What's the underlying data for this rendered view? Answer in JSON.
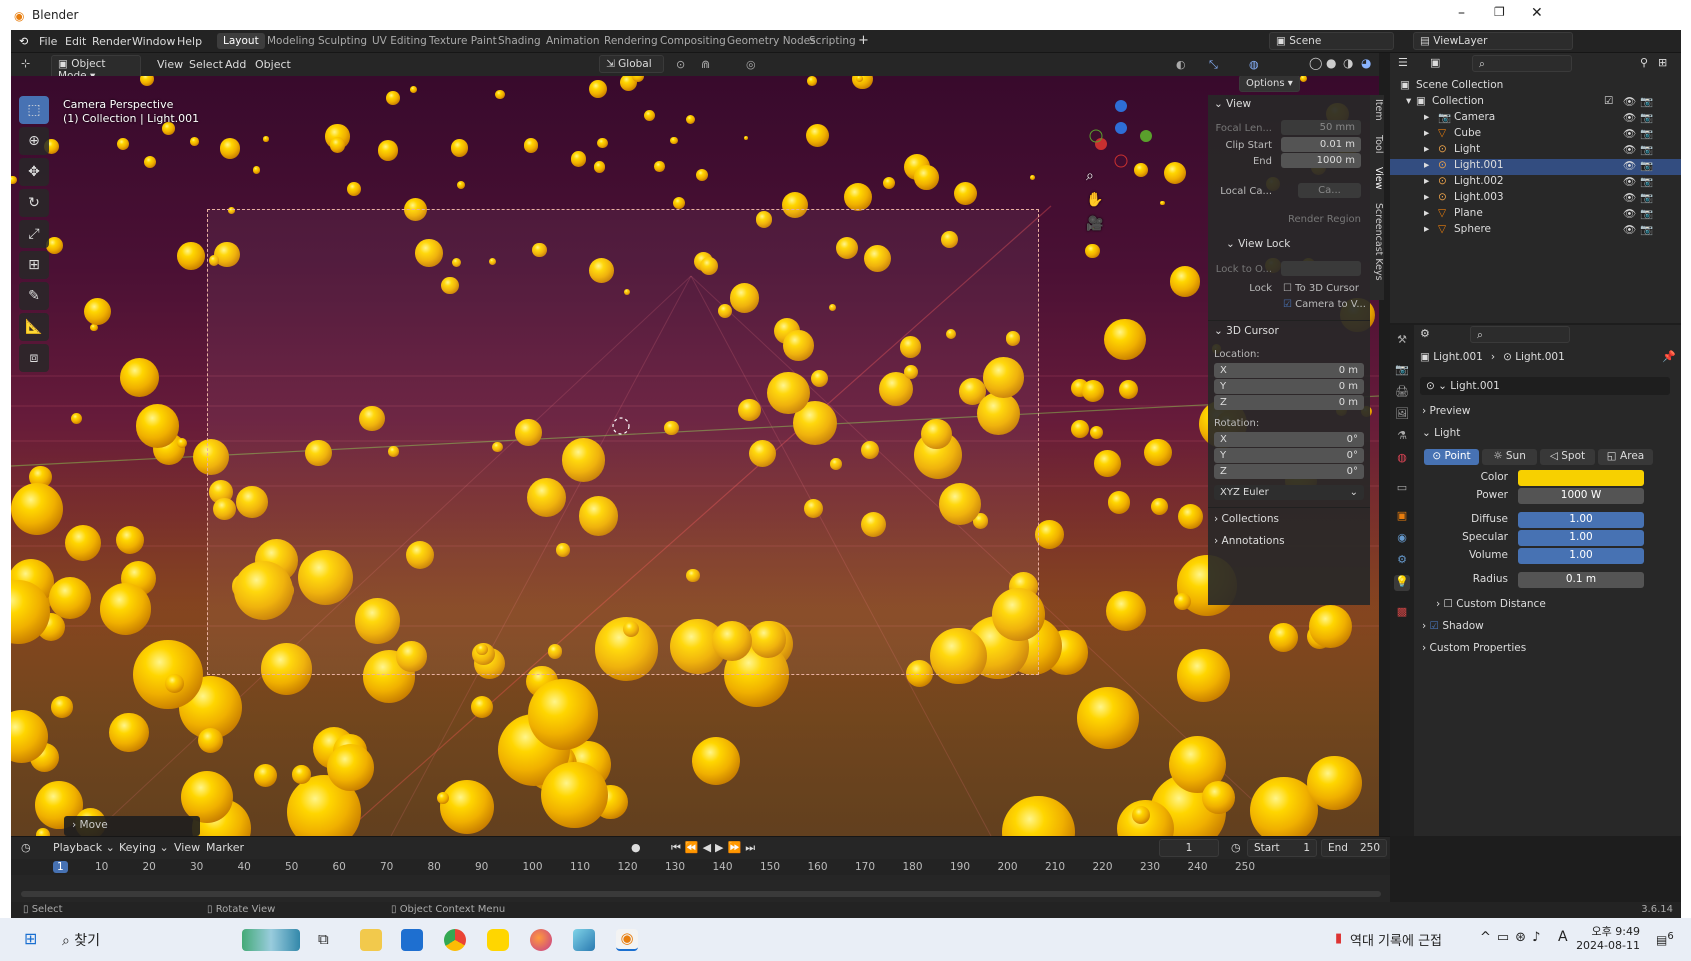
{
  "window": {
    "title": "Blender",
    "minimize": "–",
    "maximize": "❐",
    "close": "✕"
  },
  "menu": [
    "File",
    "Edit",
    "Render",
    "Window",
    "Help"
  ],
  "workspaces": [
    {
      "label": "Layout",
      "active": true
    },
    {
      "label": "Modeling",
      "active": false
    },
    {
      "label": "Sculpting",
      "active": false
    },
    {
      "label": "UV Editing",
      "active": false
    },
    {
      "label": "Texture Paint",
      "active": false
    },
    {
      "label": "Shading",
      "active": false
    },
    {
      "label": "Animation",
      "active": false
    },
    {
      "label": "Rendering",
      "active": false
    },
    {
      "label": "Compositing",
      "active": false
    },
    {
      "label": "Geometry Nodes",
      "active": false
    },
    {
      "label": "Scripting",
      "active": false
    }
  ],
  "add_workspace": "+",
  "scene": {
    "name": "Scene",
    "view_layer": "ViewLayer"
  },
  "viewport_header": {
    "mode": "Object Mode",
    "menus": [
      "View",
      "Select",
      "Add",
      "Object"
    ],
    "orientation": "Global",
    "options": "Options"
  },
  "viewport": {
    "perspective": "Camera Perspective",
    "collection_info": "(1) Collection | Light.001",
    "last_op": "Move"
  },
  "npanel": {
    "view_header": "View",
    "focal_length_label": "Focal Len...",
    "focal_length": "50 mm",
    "clip_start_label": "Clip Start",
    "clip_start": "0.01 m",
    "end_label": "End",
    "clip_end": "1000 m",
    "local_camera_label": "Local Ca...",
    "local_camera_value": "Ca...",
    "render_region": "Render Region",
    "view_lock_header": "View Lock",
    "lock_to_object_label": "Lock to O...",
    "lock_label": "Lock",
    "to_3d_cursor": "To 3D Cursor",
    "camera_to_view": "Camera to V...",
    "cursor_header": "3D Cursor",
    "location_label": "Location:",
    "loc": [
      {
        "axis": "X",
        "value": "0 m"
      },
      {
        "axis": "Y",
        "value": "0 m"
      },
      {
        "axis": "Z",
        "value": "0 m"
      }
    ],
    "rotation_label": "Rotation:",
    "rot": [
      {
        "axis": "X",
        "value": "0°"
      },
      {
        "axis": "Y",
        "value": "0°"
      },
      {
        "axis": "Z",
        "value": "0°"
      }
    ],
    "rotation_mode": "XYZ Euler",
    "collections": "Collections",
    "annotations": "Annotations",
    "tabs": [
      "Item",
      "Tool",
      "View",
      "Screencast Keys"
    ]
  },
  "outliner": {
    "root": "Scene Collection",
    "collection": "Collection",
    "items": [
      {
        "name": "Camera",
        "selected": false
      },
      {
        "name": "Cube",
        "selected": false
      },
      {
        "name": "Light",
        "selected": false
      },
      {
        "name": "Light.001",
        "selected": true
      },
      {
        "name": "Light.002",
        "selected": false
      },
      {
        "name": "Light.003",
        "selected": false
      },
      {
        "name": "Plane",
        "selected": false
      },
      {
        "name": "Sphere",
        "selected": false
      }
    ]
  },
  "properties": {
    "breadcrumb_object": "Light.001",
    "breadcrumb_data": "Light.001",
    "datablock": "Light.001",
    "preview": "Preview",
    "light_header": "Light",
    "light_types": [
      {
        "label": "Point",
        "active": true
      },
      {
        "label": "Sun",
        "active": false
      },
      {
        "label": "Spot",
        "active": false
      },
      {
        "label": "Area",
        "active": false
      }
    ],
    "color_label": "Color",
    "color": "#f7d000",
    "power_label": "Power",
    "power": "1000 W",
    "diffuse_label": "Diffuse",
    "diffuse": "1.00",
    "specular_label": "Specular",
    "specular": "1.00",
    "volume_label": "Volume",
    "volume": "1.00",
    "radius_label": "Radius",
    "radius": "0.1 m",
    "custom_distance": "Custom Distance",
    "shadow": "Shadow",
    "custom_properties": "Custom Properties"
  },
  "timeline": {
    "menus": [
      "Playback",
      "Keying",
      "View",
      "Marker"
    ],
    "current_frame": "1",
    "start_label": "Start",
    "start": "1",
    "end_label": "End",
    "end": "250",
    "ticks": [
      "1",
      "10",
      "20",
      "30",
      "40",
      "50",
      "60",
      "70",
      "80",
      "90",
      "100",
      "110",
      "120",
      "130",
      "140",
      "150",
      "160",
      "170",
      "180",
      "190",
      "200",
      "210",
      "220",
      "230",
      "240",
      "250"
    ]
  },
  "statusbar": {
    "select": "Select",
    "rotate": "Rotate View",
    "context": "Object Context Menu",
    "version": "3.6.14"
  },
  "taskbar": {
    "search": "찾기",
    "news": "역대 기록에 근접",
    "time": "오후 9:49",
    "date": "2024-08-11",
    "ime": "A",
    "notifications": "6"
  },
  "colors": {
    "accent": "#4772b3",
    "selection": "#334d80",
    "light_color": "#f7d000",
    "bar_blue": "#4772b3"
  }
}
